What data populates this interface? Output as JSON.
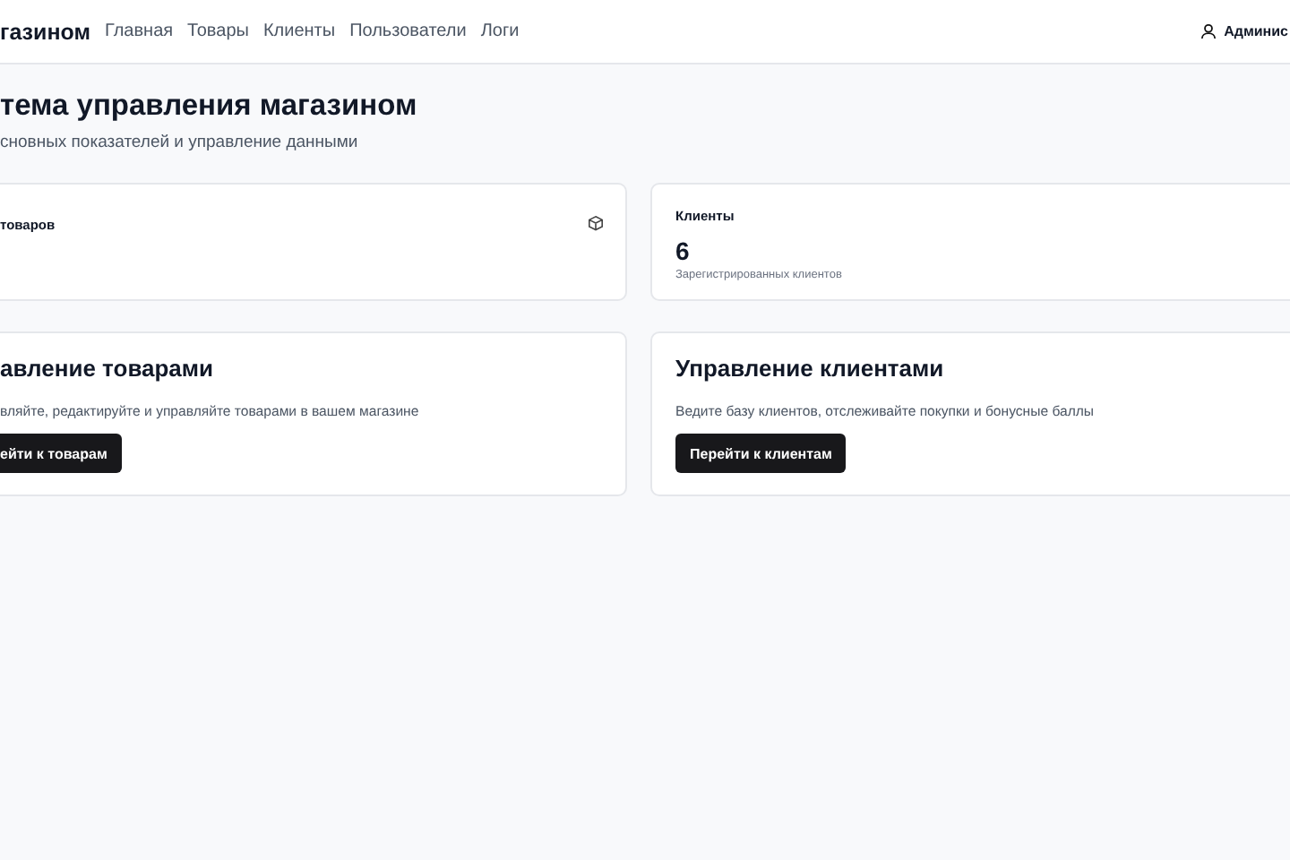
{
  "header": {
    "brand": "газином",
    "nav": [
      {
        "label": "Главная"
      },
      {
        "label": "Товары"
      },
      {
        "label": "Клиенты"
      },
      {
        "label": "Пользователи"
      },
      {
        "label": "Логи"
      }
    ],
    "user": "Админис"
  },
  "page": {
    "title": "тема управления магазином",
    "subtitle": "сновных показателей и управление данными"
  },
  "stats": [
    {
      "label": "товаров"
    },
    {
      "label": "Клиенты",
      "value": "6",
      "caption": "Зарегистрированных клиентов"
    }
  ],
  "actions": [
    {
      "title": "авление товарами",
      "description": "вляйте, редактируйте и управляйте товарами в вашем магазине",
      "button": "ейти к товарам"
    },
    {
      "title": "Управление клиентами",
      "description": "Ведите базу клиентов, отслеживайте покупки и бонусные баллы",
      "button": "Перейти к клиентам"
    }
  ]
}
